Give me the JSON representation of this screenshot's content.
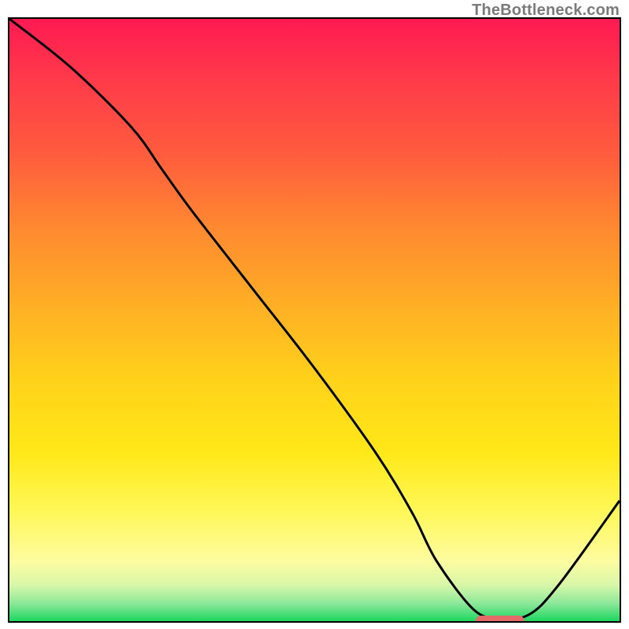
{
  "watermark": "TheBottleneck.com",
  "colors": {
    "top": "#ff1a52",
    "mid": "#ffd21a",
    "bottom": "#1ed760",
    "curve": "#000000",
    "marker": "#e46a6a",
    "border": "#000000"
  },
  "chart_data": {
    "type": "line",
    "title": "",
    "xlabel": "",
    "ylabel": "",
    "xlim": [
      0,
      100
    ],
    "ylim": [
      0,
      100
    ],
    "x": [
      0,
      10,
      20,
      25,
      30,
      40,
      50,
      60,
      66,
      70,
      76,
      80,
      85,
      90,
      100
    ],
    "y": [
      100,
      92,
      82,
      75,
      68,
      55,
      42,
      28,
      18,
      10,
      2,
      0.5,
      1,
      6,
      20
    ],
    "marker_region": {
      "x_start": 76,
      "x_end": 84,
      "y": 0.5
    }
  }
}
